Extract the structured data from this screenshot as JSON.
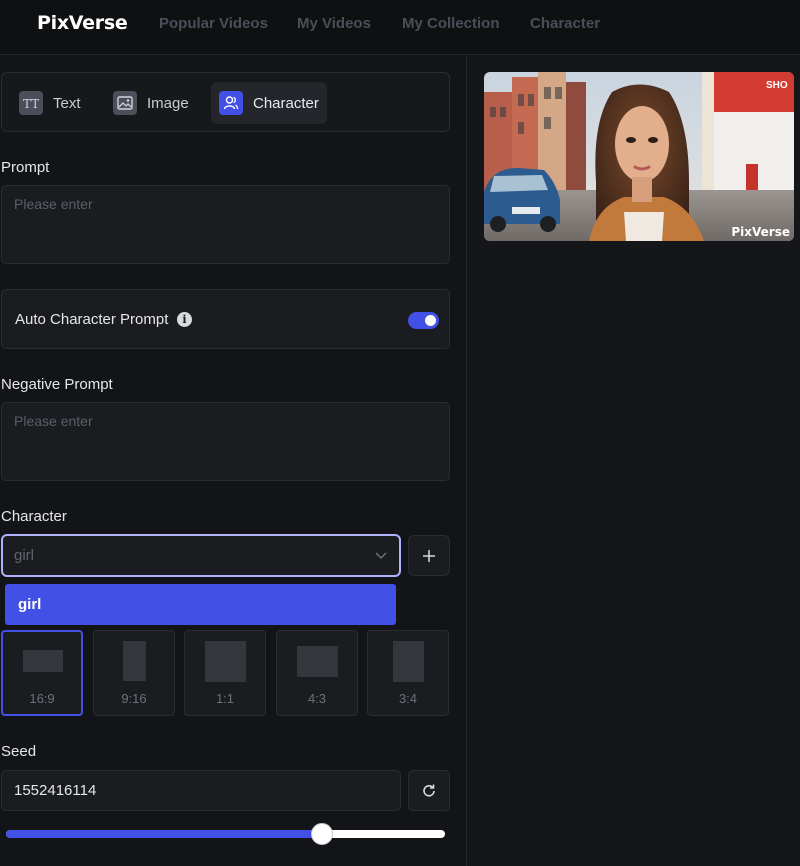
{
  "header": {
    "logo": "PixVerse",
    "nav": [
      "Popular Videos",
      "My Videos",
      "My Collection",
      "Character"
    ]
  },
  "mode_tabs": [
    {
      "label": "Text",
      "icon": "text-icon",
      "active": false
    },
    {
      "label": "Image",
      "icon": "image-icon",
      "active": false
    },
    {
      "label": "Character",
      "icon": "character-icon",
      "active": true
    }
  ],
  "prompt": {
    "label": "Prompt",
    "placeholder": "Please enter"
  },
  "auto_character_prompt": {
    "label": "Auto Character Prompt",
    "info_icon": "info-icon",
    "enabled": true
  },
  "negative_prompt": {
    "label": "Negative Prompt",
    "placeholder": "Please enter"
  },
  "character": {
    "label": "Character",
    "selected": "girl",
    "dropdown_options": [
      "girl"
    ]
  },
  "aspect_ratios": [
    {
      "label": "16:9",
      "selected": true
    },
    {
      "label": "9:16",
      "selected": false
    },
    {
      "label": "1:1",
      "selected": false
    },
    {
      "label": "4:3",
      "selected": false
    },
    {
      "label": "3:4",
      "selected": false
    }
  ],
  "seed": {
    "label": "Seed",
    "value": "1552416114",
    "slider_fraction": 0.72
  },
  "preview": {
    "watermark": "PixVerse"
  },
  "colors": {
    "accent": "#4350e6",
    "background": "#131417",
    "panel": "#1b1c20",
    "focus_border": "#aeb2ff"
  }
}
